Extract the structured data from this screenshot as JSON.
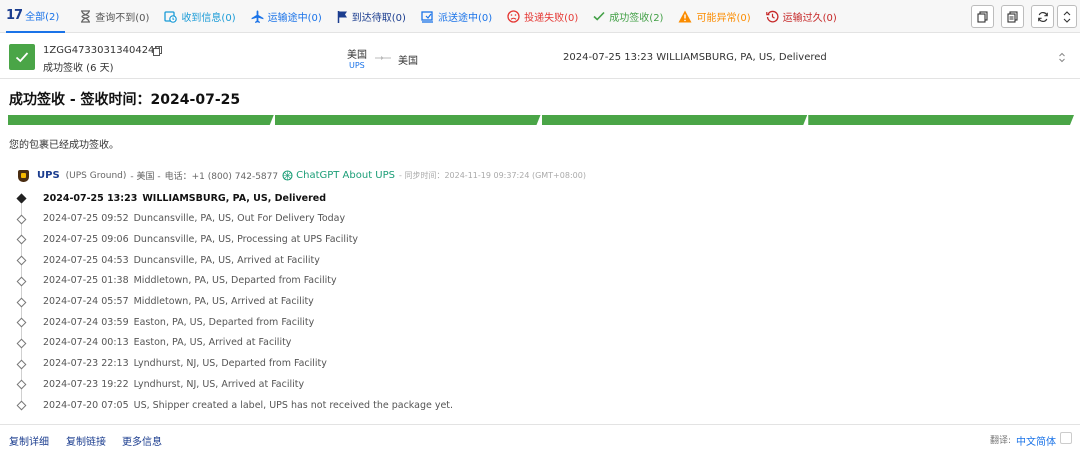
{
  "filter_tabs": [
    {
      "label": "全部(2)",
      "color": "#1a73e8",
      "icon": "brand-logo"
    },
    {
      "label": "查询不到(0)",
      "color": "#555555",
      "icon": "hourglass-icon"
    },
    {
      "label": "收到信息(0)",
      "color": "#1a9bd7",
      "icon": "clock-icon"
    },
    {
      "label": "运输途中(0)",
      "color": "#1a73e8",
      "icon": "plane-icon"
    },
    {
      "label": "到达待取(0)",
      "color": "#1b3d8f",
      "icon": "flag-icon"
    },
    {
      "label": "派送途中(0)",
      "color": "#1a73e8",
      "icon": "truck-icon"
    },
    {
      "label": "投递失败(0)",
      "color": "#e53935",
      "icon": "sad-face-icon"
    },
    {
      "label": "成功签收(2)",
      "color": "#43a047",
      "icon": "check-icon"
    },
    {
      "label": "可能异常(0)",
      "color": "#fb8c00",
      "icon": "warning-icon"
    },
    {
      "label": "运输过久(0)",
      "color": "#c62828",
      "icon": "history-icon"
    }
  ],
  "brand": {
    "logo_text": "17"
  },
  "package": {
    "tracking_number": "1ZGG47330313404240",
    "status_short": "成功签收 (6 天)",
    "origin": "美国",
    "carrier_short": "UPS",
    "destination": "美国",
    "latest_event": "2024-07-25 13:23  WILLIAMSBURG, PA, US, Delivered"
  },
  "headline": "成功签收 - 签收时间：2024-07-25",
  "progress": {
    "segments_completed": 4,
    "segments_total": 4,
    "color": "#4aa547"
  },
  "description": "您的包裹已经成功签收。",
  "carrier_info": {
    "name": "UPS",
    "service": "(UPS Ground)",
    "country": "- 美国 -",
    "phone": "电话：+1 (800) 742-5877",
    "chatgpt_label": "ChatGPT About UPS",
    "sync_time": "- 同步时间：2024-11-19 09:37:24 (GMT+08:00)"
  },
  "events": [
    {
      "datetime": "2024-07-25 13:23",
      "text": "WILLIAMSBURG, PA, US, Delivered"
    },
    {
      "datetime": "2024-07-25 09:52",
      "text": "Duncansville, PA, US, Out For Delivery Today"
    },
    {
      "datetime": "2024-07-25 09:06",
      "text": "Duncansville, PA, US, Processing at UPS Facility"
    },
    {
      "datetime": "2024-07-25 04:53",
      "text": "Duncansville, PA, US, Arrived at Facility"
    },
    {
      "datetime": "2024-07-25 01:38",
      "text": "Middletown, PA, US, Departed from Facility"
    },
    {
      "datetime": "2024-07-24 05:57",
      "text": "Middletown, PA, US, Arrived at Facility"
    },
    {
      "datetime": "2024-07-24 03:59",
      "text": "Easton, PA, US, Departed from Facility"
    },
    {
      "datetime": "2024-07-24 00:13",
      "text": "Easton, PA, US, Arrived at Facility"
    },
    {
      "datetime": "2024-07-23 22:13",
      "text": "Lyndhurst, NJ, US, Departed from Facility"
    },
    {
      "datetime": "2024-07-23 19:22",
      "text": "Lyndhurst, NJ, US, Arrived at Facility"
    },
    {
      "datetime": "2024-07-20 07:05",
      "text": "US, Shipper created a label, UPS has not received the package yet."
    }
  ],
  "footer": {
    "copy_details": "复制详细",
    "copy_link": "复制链接",
    "more_info": "更多信息",
    "translate_label": "翻译:",
    "language": "中文简体"
  }
}
